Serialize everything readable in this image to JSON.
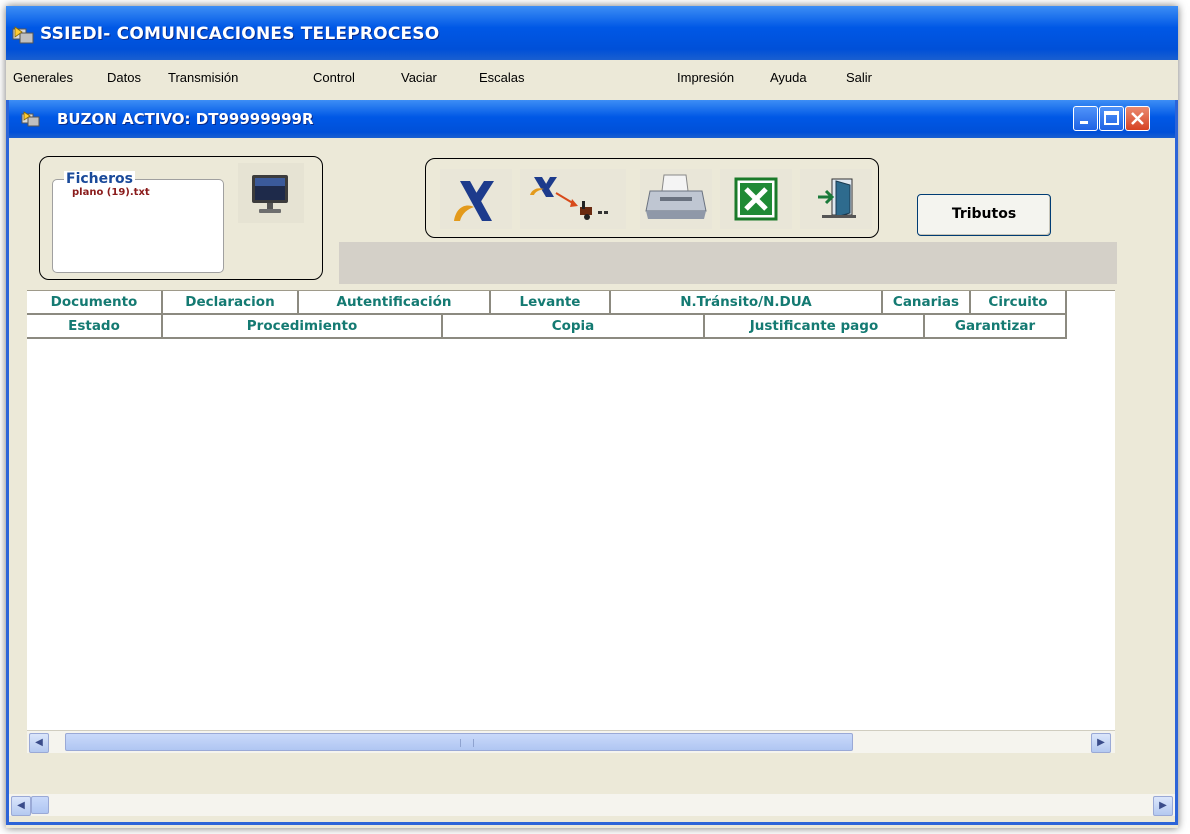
{
  "app": {
    "title": "SSIEDI- COMUNICACIONES TELEPROCESO",
    "icon": "app-logo-icon"
  },
  "menu": [
    {
      "id": "generales",
      "label": "Generales"
    },
    {
      "id": "datos",
      "label": "Datos"
    },
    {
      "id": "transmision",
      "label": "Transmisión"
    },
    {
      "id": "control",
      "label": "Control"
    },
    {
      "id": "vaciar",
      "label": "Vaciar"
    },
    {
      "id": "escalas",
      "label": "Escalas"
    },
    {
      "id": "impresion",
      "label": "Impresión"
    },
    {
      "id": "ayuda",
      "label": "Ayuda"
    },
    {
      "id": "salir",
      "label": "Salir"
    }
  ],
  "child": {
    "title": "BUZON ACTIVO:  DT99999999R",
    "window_buttons": [
      "minimize-icon",
      "maximize-icon",
      "close-icon"
    ]
  },
  "files": {
    "legend": "Ficheros",
    "items": [
      "plano (19).txt"
    ],
    "monitor_icon": "monitor-icon"
  },
  "toolbar": {
    "buttons": [
      {
        "id": "aeat",
        "icon": "aeat-logo-icon"
      },
      {
        "id": "transmit",
        "icon": "transmit-icon"
      },
      {
        "id": "print",
        "icon": "printer-icon"
      },
      {
        "id": "excel",
        "icon": "excel-icon"
      },
      {
        "id": "exit",
        "icon": "exit-door-icon"
      }
    ],
    "tributos_label": "Tributos"
  },
  "grid": {
    "header_row1": [
      {
        "id": "documento",
        "label": "Documento"
      },
      {
        "id": "declaracion",
        "label": "Declaracion"
      },
      {
        "id": "autentificacion",
        "label": "Autentificación"
      },
      {
        "id": "levante",
        "label": "Levante"
      },
      {
        "id": "ntransito",
        "label": "N.Tránsito/N.DUA"
      },
      {
        "id": "canarias",
        "label": "Canarias"
      },
      {
        "id": "circuito",
        "label": "Circuito"
      }
    ],
    "header_row2": [
      {
        "id": "estado",
        "label": "Estado"
      },
      {
        "id": "procedimiento",
        "label": "Procedimiento"
      },
      {
        "id": "copia",
        "label": "Copia"
      },
      {
        "id": "justificante",
        "label": "Justificante pago"
      },
      {
        "id": "garantizar",
        "label": "Garantizar"
      }
    ],
    "rows": []
  },
  "colors": {
    "title_blue": "#0058e6",
    "header_text": "#147a72",
    "file_text": "#8a1b1b",
    "legend_text": "#1a4a9a",
    "face": "#ece9d8"
  }
}
